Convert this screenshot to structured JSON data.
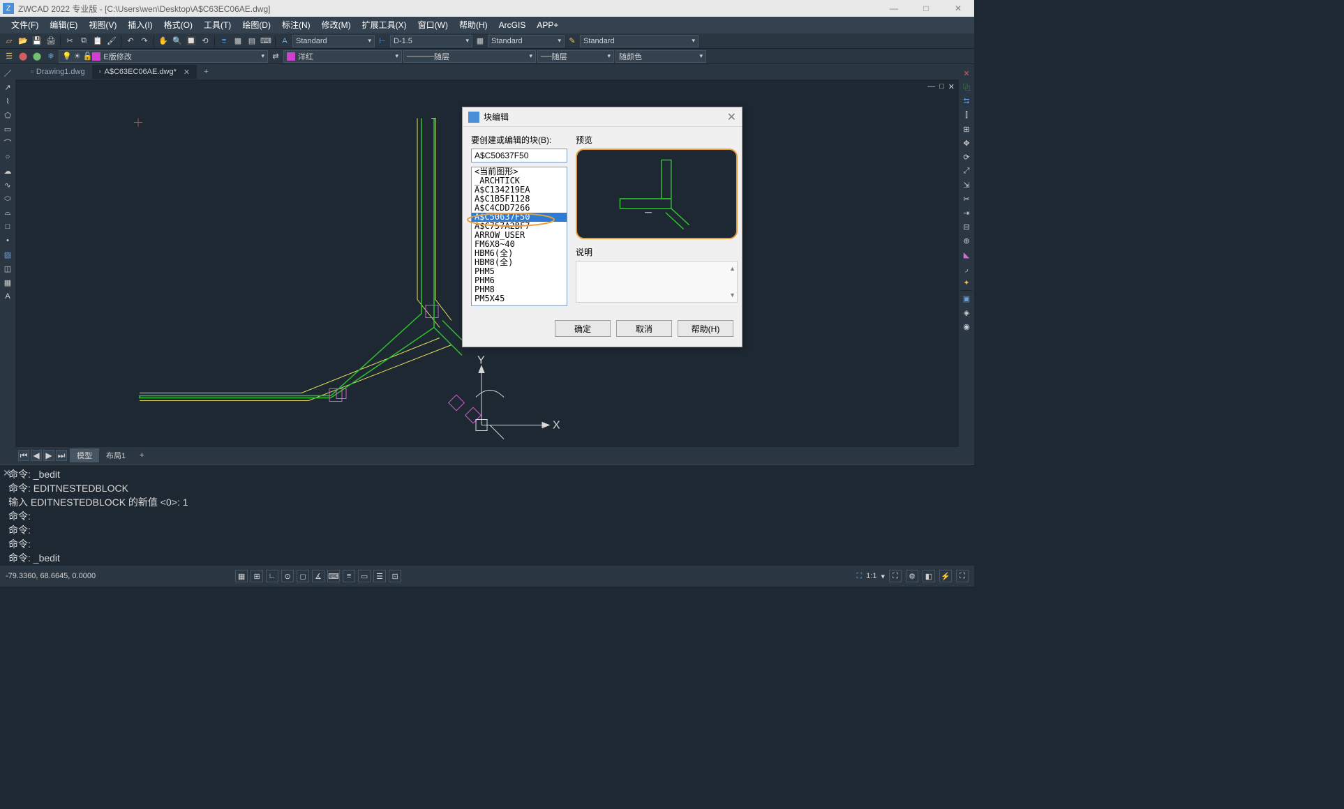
{
  "app": {
    "title": "ZWCAD 2022 专业版 - [C:\\Users\\wen\\Desktop\\A$C63EC06AE.dwg]"
  },
  "menu": {
    "items": [
      "文件(F)",
      "编辑(E)",
      "视图(V)",
      "插入(I)",
      "格式(O)",
      "工具(T)",
      "绘图(D)",
      "标注(N)",
      "修改(M)",
      "扩展工具(X)",
      "窗口(W)",
      "帮助(H)",
      "ArcGIS",
      "APP+"
    ]
  },
  "toolbar1": {
    "style1": "Standard",
    "style2": "D-1.5",
    "style3": "Standard",
    "style4": "Standard"
  },
  "toolbar2": {
    "layer": "E版修改",
    "color": "洋红",
    "linetype": "随层",
    "lineweight": "随层",
    "plotstyle": "随颜色"
  },
  "tabs": {
    "tab1": "Drawing1.dwg",
    "tab2": "A$C63EC06AE.dwg*"
  },
  "layout": {
    "model": "模型",
    "layout1": "布局1",
    "add": "+"
  },
  "cmd": {
    "l1": "命令: _bedit",
    "l2": "命令: EDITNESTEDBLOCK",
    "l3": "输入 EDITNESTEDBLOCK 的新值 <0>: 1",
    "l4": "命令:",
    "l5": "命令:",
    "l6": "命令:",
    "l7": "命令: _bedit"
  },
  "status": {
    "coords": "-79.3360, 68.6645, 0.0000",
    "ratio": "1:1"
  },
  "dialog": {
    "title": "块编辑",
    "label_block": "要创建或编辑的块(B):",
    "input_value": "A$C50637F50",
    "preview_label": "预览",
    "desc_label": "说明",
    "btn_ok": "确定",
    "btn_cancel": "取消",
    "btn_help": "帮助(H)",
    "list": {
      "o0": "<当前图形>",
      "o1": "_ARCHTICK",
      "o2": "A$C134219EA",
      "o3": "A$C1B5F1128",
      "o4": "A$C4CDD7266",
      "o5": "A$C50637F50",
      "o6": "A$C757A2BF7",
      "o7": "ARROW_USER",
      "o8": "FM6X8~40",
      "o9": "HBM6(全)",
      "o10": "HBM8(全)",
      "o11": "PHM5",
      "o12": "PHM6",
      "o13": "PHM8",
      "o14": "PM5X45"
    }
  },
  "axis": {
    "x": "X",
    "y": "Y"
  },
  "canvas_ctrl": {
    "min": "—",
    "max": "□",
    "close": "✕"
  },
  "win": {
    "min": "—",
    "max": "□",
    "close": "✕"
  }
}
